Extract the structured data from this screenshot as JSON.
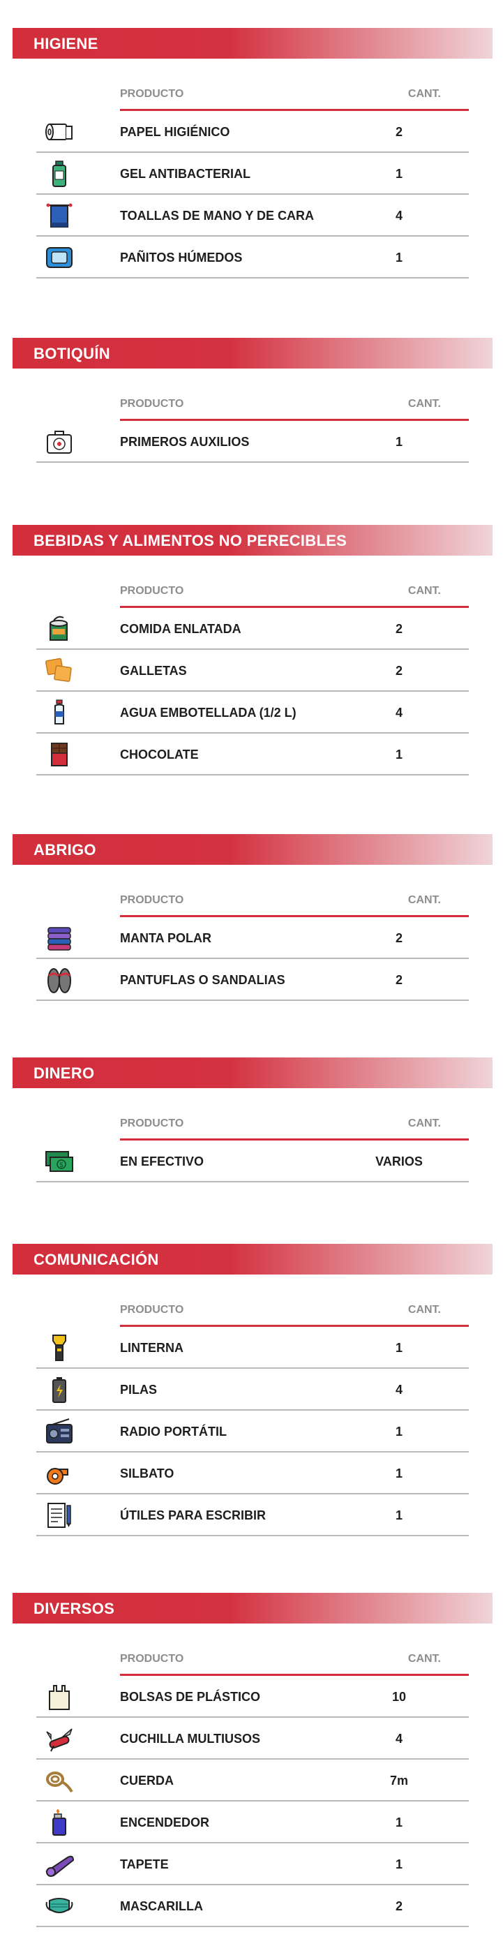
{
  "table_header": {
    "product": "PRODUCTO",
    "qty": "CANT."
  },
  "sections": [
    {
      "title": "HIGIENE",
      "items": [
        {
          "name": "PAPEL HIGIÉNICO",
          "qty": "2",
          "icon": "toilet-paper-icon"
        },
        {
          "name": "GEL ANTIBACTERIAL",
          "qty": "1",
          "icon": "hand-sanitizer-icon"
        },
        {
          "name": "TOALLAS DE MANO Y DE CARA",
          "qty": "4",
          "icon": "towel-icon"
        },
        {
          "name": "PAÑITOS HÚMEDOS",
          "qty": "1",
          "icon": "wet-wipes-icon"
        }
      ]
    },
    {
      "title": "BOTIQUÍN",
      "items": [
        {
          "name": "PRIMEROS AUXILIOS",
          "qty": "1",
          "icon": "first-aid-kit-icon"
        }
      ]
    },
    {
      "title": "BEBIDAS Y ALIMENTOS NO PERECIBLES",
      "items": [
        {
          "name": "COMIDA ENLATADA",
          "qty": "2",
          "icon": "canned-food-icon"
        },
        {
          "name": "GALLETAS",
          "qty": "2",
          "icon": "crackers-icon"
        },
        {
          "name": "AGUA EMBOTELLADA (1/2 L)",
          "qty": "4",
          "icon": "water-bottle-icon"
        },
        {
          "name": "CHOCOLATE",
          "qty": "1",
          "icon": "chocolate-icon"
        }
      ]
    },
    {
      "title": "ABRIGO",
      "items": [
        {
          "name": "MANTA POLAR",
          "qty": "2",
          "icon": "folded-blankets-icon"
        },
        {
          "name": "PANTUFLAS O SANDALIAS",
          "qty": "2",
          "icon": "sandals-icon"
        }
      ]
    },
    {
      "title": "DINERO",
      "items": [
        {
          "name": "EN EFECTIVO",
          "qty": "VARIOS",
          "icon": "cash-icon"
        }
      ]
    },
    {
      "title": "COMUNICACIÓN",
      "items": [
        {
          "name": "LINTERNA",
          "qty": "1",
          "icon": "flashlight-icon"
        },
        {
          "name": "PILAS",
          "qty": "4",
          "icon": "battery-icon"
        },
        {
          "name": "RADIO PORTÁTIL",
          "qty": "1",
          "icon": "radio-icon"
        },
        {
          "name": "SILBATO",
          "qty": "1",
          "icon": "whistle-icon"
        },
        {
          "name": "ÚTILES PARA ESCRIBIR",
          "qty": "1",
          "icon": "notepad-pen-icon"
        }
      ]
    },
    {
      "title": "DIVERSOS",
      "items": [
        {
          "name": "BOLSAS DE PLÁSTICO",
          "qty": "10",
          "icon": "plastic-bag-icon"
        },
        {
          "name": "CUCHILLA MULTIUSOS",
          "qty": "4",
          "icon": "multitool-knife-icon"
        },
        {
          "name": "CUERDA",
          "qty": "7m",
          "icon": "rope-icon"
        },
        {
          "name": "ENCENDEDOR",
          "qty": "1",
          "icon": "lighter-icon"
        },
        {
          "name": "TAPETE",
          "qty": "1",
          "icon": "mat-icon"
        },
        {
          "name": "MASCARILLA",
          "qty": "2",
          "icon": "face-mask-icon"
        }
      ]
    }
  ]
}
